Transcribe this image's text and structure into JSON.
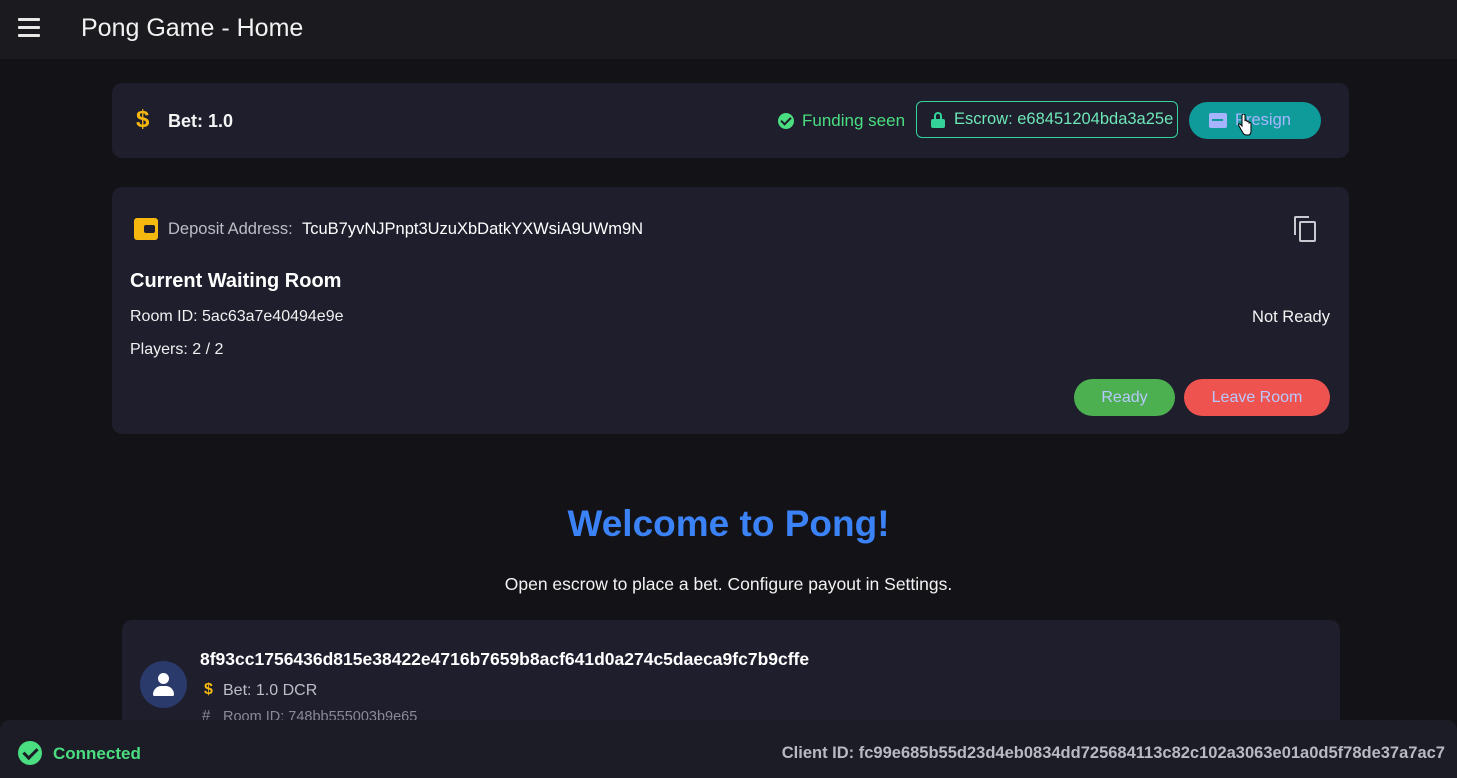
{
  "appbar": {
    "title": "Pong Game - Home",
    "menu_icon": "menu-icon"
  },
  "bet_card": {
    "currency_symbol": "$",
    "bet_label": "Bet: 1.0",
    "funding_status": "Funding seen",
    "escrow_label": "Escrow: e68451204bda3a25e",
    "presign_label": "Presign"
  },
  "room_card": {
    "deposit_label": "Deposit Address:",
    "deposit_address": "TcuB7yvNJPnpt3UzuXbDatkYXWsiA9UWm9N",
    "title": "Current Waiting Room",
    "room_id": "Room ID: 5ac63a7e40494e9e",
    "players": "Players: 2 / 2",
    "ready_status": "Not Ready",
    "ready_button": "Ready",
    "leave_button": "Leave Room"
  },
  "welcome": {
    "title": "Welcome to Pong!",
    "subtitle": "Open escrow to place a bet. Configure payout in Settings."
  },
  "rooms_list": [
    {
      "host_id": "8f93cc1756436d815e38422e4716b7659b8acf641d0a274c5daeca9fc7b9cffe",
      "bet": "Bet: 1.0 DCR",
      "room_id": "Room ID: 748bb555003b9e65"
    }
  ],
  "status_bar": {
    "connection": "Connected",
    "client_id": "Client ID: fc99e685b55d23d4eb0834dd725684113c82c102a3063e01a0d5f78de37a7ac7"
  },
  "colors": {
    "background": "#131217",
    "card": "#1e1e2d",
    "accent_blue": "#3b82f6",
    "success": "#4ade80",
    "gold": "#f5b80f",
    "teal_button": "#0e9b9a",
    "ready_green": "#4caf50",
    "leave_red": "#ef5350"
  }
}
